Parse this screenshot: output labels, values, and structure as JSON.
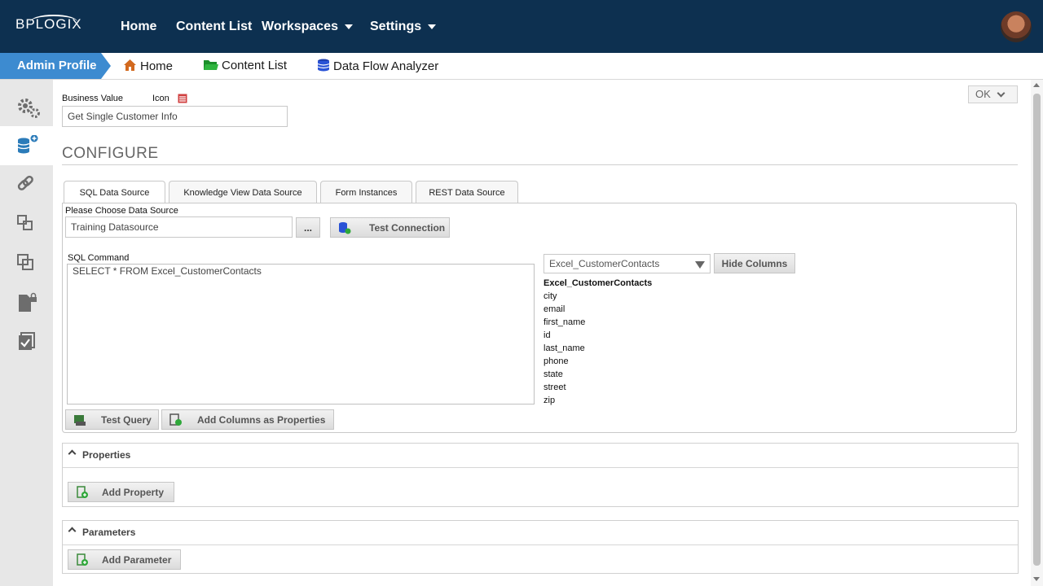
{
  "header": {
    "logo": "BPLOGIX",
    "nav": [
      "Home",
      "Content List",
      "Workspaces",
      "Settings"
    ]
  },
  "breadcrumb": {
    "admin": "Admin Profile",
    "items": [
      "Home",
      "Content List",
      "Data Flow Analyzer"
    ]
  },
  "form": {
    "business_value_label": "Business Value",
    "icon_label": "Icon",
    "business_value": "Get Single Customer Info",
    "ok_label": "OK",
    "section_title": "CONFIGURE",
    "tabs": [
      "SQL Data Source",
      "Knowledge View Data Source",
      "Form Instances",
      "REST Data Source"
    ],
    "datasource_label": "Please Choose Data Source",
    "datasource_value": "Training Datasource",
    "browse_label": "...",
    "test_connection": "Test Connection",
    "sql_label": "SQL Command",
    "sql_value": "SELECT * FROM Excel_CustomerContacts",
    "table_select": "Excel_CustomerContacts",
    "hide_columns": "Hide Columns",
    "columns_header": "Excel_CustomerContacts",
    "columns": [
      "city",
      "email",
      "first_name",
      "id",
      "last_name",
      "phone",
      "state",
      "street",
      "zip"
    ],
    "test_query": "Test Query",
    "add_columns": "Add Columns as Properties"
  },
  "properties": {
    "title": "Properties",
    "add": "Add Property"
  },
  "parameters": {
    "title": "Parameters",
    "add": "Add Parameter"
  }
}
